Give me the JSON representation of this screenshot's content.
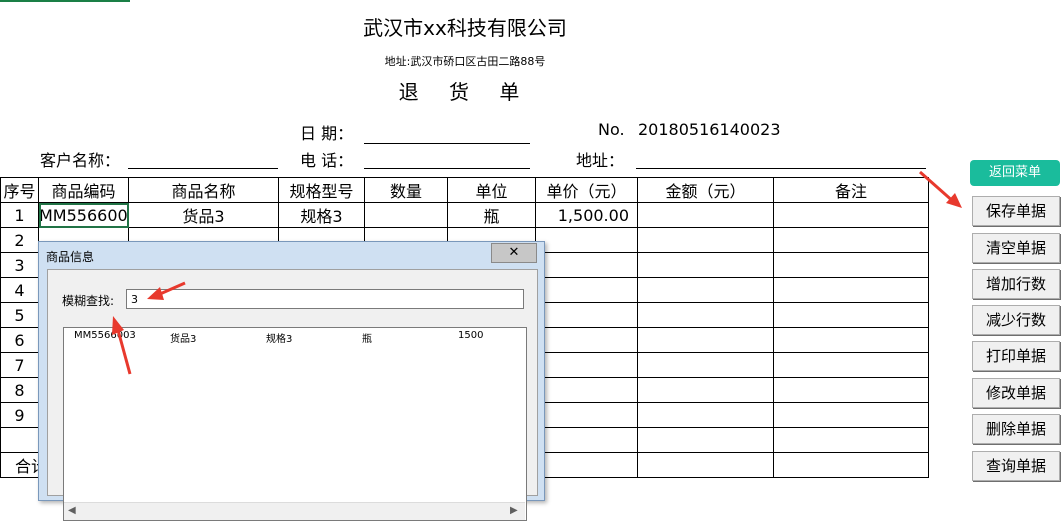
{
  "header": {
    "company": "武汉市xx科技有限公司",
    "address": "地址:武汉市硚口区古田二路88号",
    "doc_title": "退 货 单"
  },
  "fields": {
    "date_label": "日 期：",
    "no_label": "No.",
    "no_value": "20180516140023",
    "customer_label": "客户名称：",
    "phone_label": "电 话：",
    "addr_label": "地址："
  },
  "table": {
    "headers": [
      "序号",
      "商品编码",
      "商品名称",
      "规格型号",
      "数量",
      "单位",
      "单价（元）",
      "金额（元）",
      "备注"
    ],
    "row1": [
      "1",
      "MM556600",
      "货品3",
      "规格3",
      "",
      "瓶",
      "1,500.00",
      "",
      ""
    ],
    "row_numbers": [
      "2",
      "3",
      "4",
      "5",
      "6",
      "7",
      "8",
      "9",
      ""
    ],
    "total_label": "合计"
  },
  "buttons": {
    "return": "返回菜单",
    "save": "保存单据",
    "clear": "清空单据",
    "add_row": "增加行数",
    "remove_row": "减少行数",
    "print": "打印单据",
    "modify": "修改单据",
    "delete": "删除单据",
    "query": "查询单据"
  },
  "dialog": {
    "title": "商品信息",
    "close": "✕",
    "search_label": "模糊查找:",
    "search_value": "3",
    "result": {
      "code": "MM5566003",
      "name": "货品3",
      "spec": "规格3",
      "unit": "瓶",
      "price": "1500"
    }
  },
  "colors": {
    "accent_green": "#1abc9c",
    "arrow_red": "#e8392d",
    "excel_green": "#217346"
  }
}
